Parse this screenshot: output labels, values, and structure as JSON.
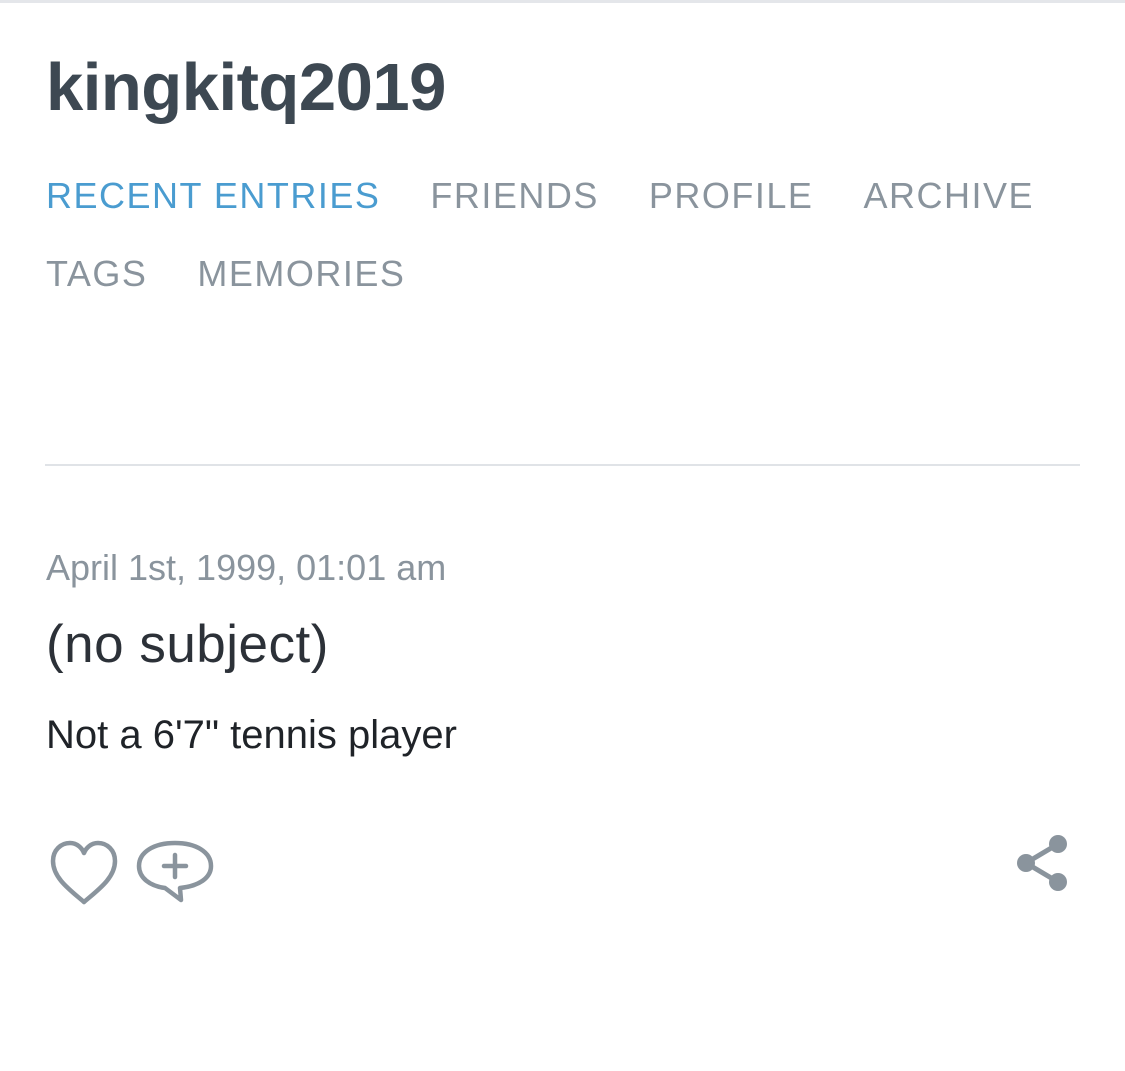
{
  "journal": {
    "title": "kingkitq2019"
  },
  "nav": {
    "items": [
      {
        "label": "RECENT ENTRIES",
        "active": true
      },
      {
        "label": "FRIENDS",
        "active": false
      },
      {
        "label": "PROFILE",
        "active": false
      },
      {
        "label": "ARCHIVE",
        "active": false
      },
      {
        "label": "TAGS",
        "active": false
      },
      {
        "label": "MEMORIES",
        "active": false
      }
    ]
  },
  "entry": {
    "date": "April 1st, 1999, 01:01 am",
    "subject": "(no subject)",
    "body": "Not a 6'7\" tennis player",
    "actions": {
      "like_icon": "heart-icon",
      "comment_icon": "comment-add-icon",
      "share_icon": "share-icon"
    }
  },
  "colors": {
    "title": "#3d4852",
    "nav_active": "#4a9cd0",
    "nav_inactive": "#8a949d",
    "meta": "#8a949d",
    "text": "#1f2328",
    "icon": "#8a949d",
    "divider": "#e0e3e7"
  }
}
